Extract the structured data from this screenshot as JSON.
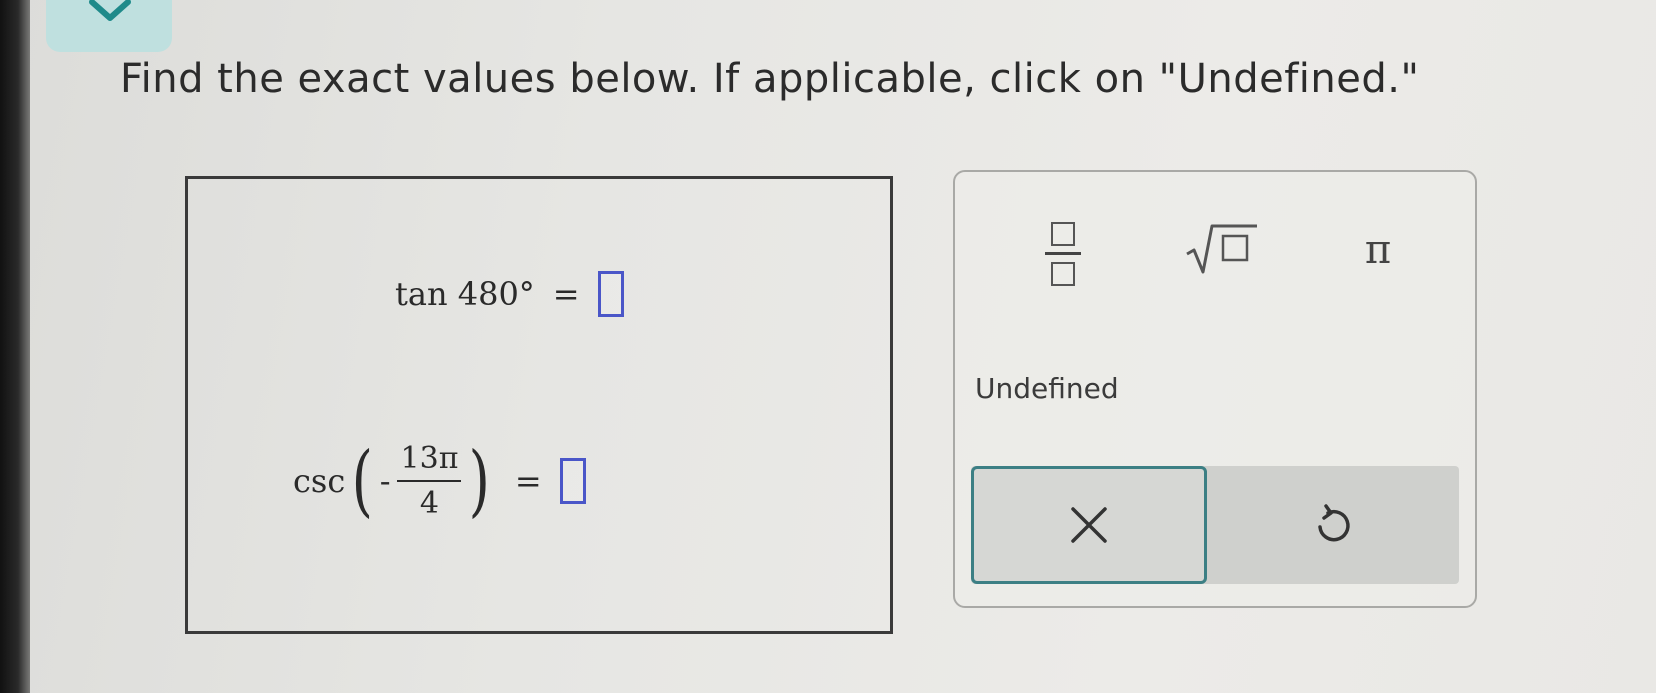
{
  "prompt": {
    "instructions": "Find the exact values below. If applicable, click on \"Undefined.\""
  },
  "problems": [
    {
      "function_text": "tan 480°",
      "equals": "=",
      "answer_value": ""
    },
    {
      "function_text": "csc",
      "negative_sign": "-",
      "numerator": "13π",
      "denominator": "4",
      "equals": "=",
      "answer_value": ""
    }
  ],
  "keypad": {
    "pi_label": "π",
    "undefined_label": "Undefined",
    "icons": [
      "fraction-template-icon",
      "square-root-template-icon",
      "close-icon",
      "undo-icon",
      "chevron-down-icon"
    ]
  },
  "colors": {
    "answer_box_border": "#4a56c8",
    "accent_teal": "#3c7f84",
    "collapse_tab": "#bfe0df"
  }
}
